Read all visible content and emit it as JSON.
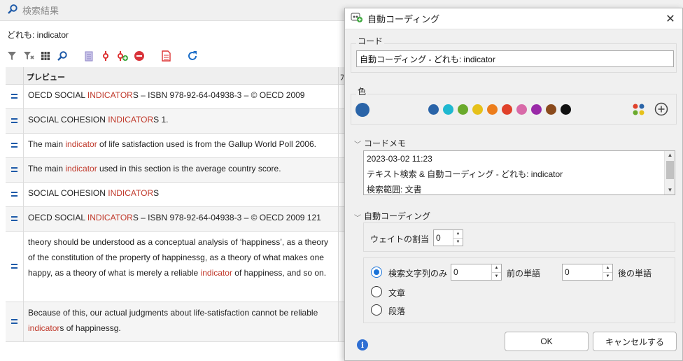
{
  "search": {
    "title": "検索結果",
    "query": "どれも: indicator",
    "column_preview": "プレビュー",
    "column_2": "ﾌ",
    "rows": [
      {
        "pre": "OECD SOCIAL ",
        "hit": "INDICATOR",
        "post": "S – ISBN 978-92-64-04938-3 – © OECD 2009"
      },
      {
        "pre": "SOCIAL COHESION ",
        "hit": "INDICATOR",
        "post": "S  1."
      },
      {
        "pre": "The main ",
        "hit": "indicator",
        "post": " of life satisfaction used is  from the Gallup World Poll 2006."
      },
      {
        "pre": "The main  ",
        "hit": "indicator",
        "post": " used in this section is the average  country score."
      },
      {
        "pre": "SOCIAL COHESION ",
        "hit": "INDICATOR",
        "post": "S"
      },
      {
        "pre": "OECD SOCIAL ",
        "hit": "INDICATOR",
        "post": "S – ISBN 978-92-64-04938-3 – © OECD 2009 121"
      },
      {
        "pre": "theory should be   understood as a conceptual analysis of ‘happiness’, as a theory of the constitution of the property of happinessg, as a   theory of what makes one happy, as a theory of what is merely a reliable ",
        "hit": "indicator",
        "post": " of happiness, and so on."
      },
      {
        "pre": "Because of this, our actual judgments about life-satisfaction cannot be reliable ",
        "hit": "indicator",
        "post": "s of happinessg."
      }
    ]
  },
  "dialog": {
    "title": "自動コーディング",
    "code_label": "コード",
    "code_value": "自動コーディング - どれも: indicator",
    "color_label": "色",
    "selected_color": "#2a64a8",
    "colors": [
      "#2a64a8",
      "#1fb8d0",
      "#6aaa2c",
      "#e6c11a",
      "#ec7d1c",
      "#e0412a",
      "#d86aa8",
      "#9a2aa8",
      "#8a4a1c",
      "#111111"
    ],
    "memo_label": "コードメモ",
    "memo_lines": [
      "2023-03-02 11:23",
      "テキスト検索 & 自動コーディング - どれも: indicator",
      "検索範囲: 文書"
    ],
    "autocode_label": "自動コーディング",
    "weight_label": "ウェイトの割当",
    "weight_value": "0",
    "option_search_only": "検索文字列のみ",
    "before_value": "0",
    "before_label": "前の単語",
    "after_value": "0",
    "after_label": "後の単語",
    "option_sentence": "文章",
    "option_paragraph": "段落",
    "ok_label": "OK",
    "cancel_label": "キャンセルする"
  }
}
